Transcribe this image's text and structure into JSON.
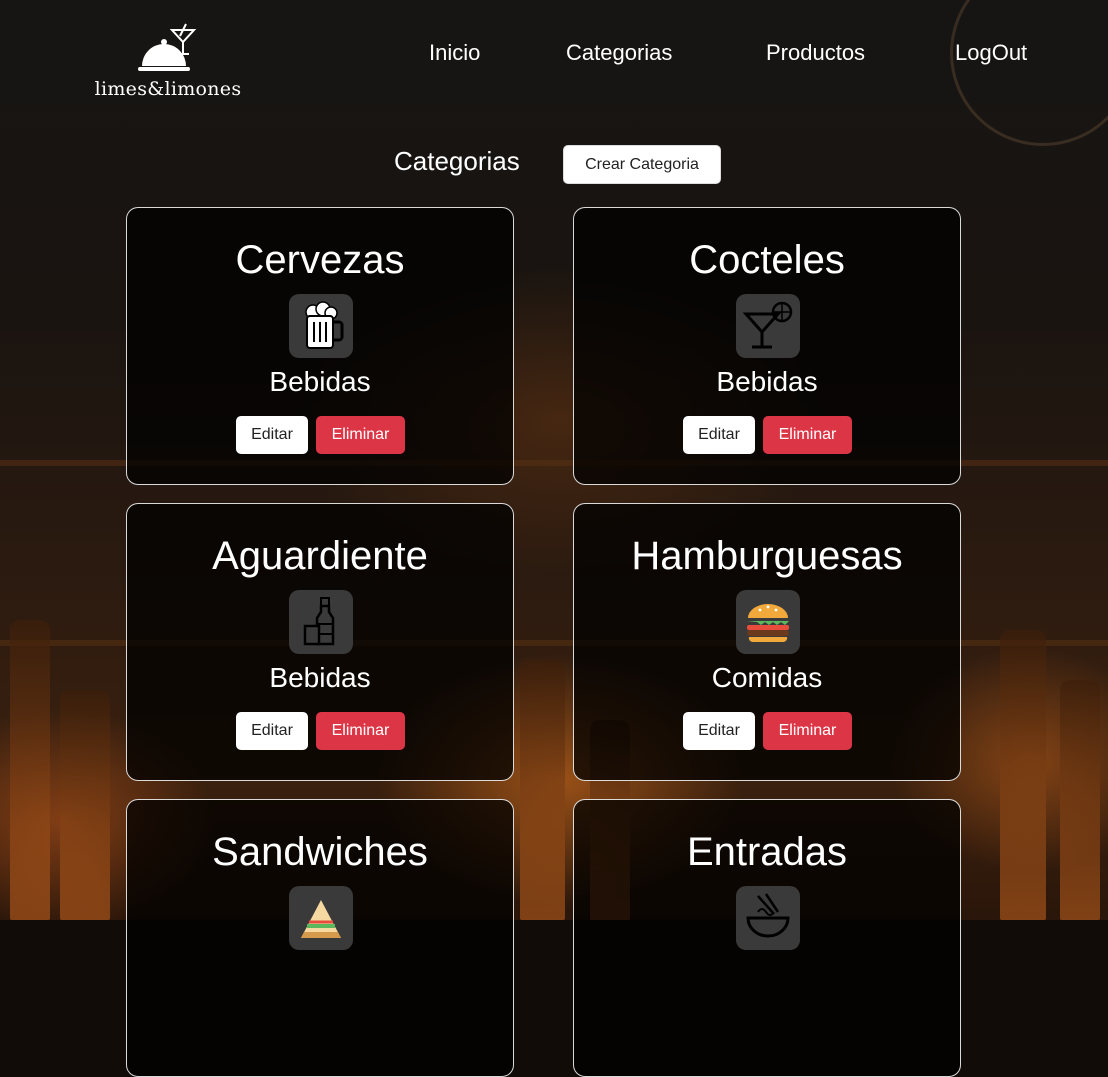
{
  "brand": {
    "name": "limes&limones",
    "icon": "cloche-cocktail-icon"
  },
  "nav": [
    {
      "label": "Inicio"
    },
    {
      "label": "Categorias"
    },
    {
      "label": "Productos"
    },
    {
      "label": "LogOut"
    }
  ],
  "page": {
    "title": "Categorias",
    "create_label": "Crear Categoria"
  },
  "actions": {
    "edit": "Editar",
    "delete": "Eliminar"
  },
  "categories": [
    {
      "name": "Cervezas",
      "group": "Bebidas",
      "icon": "beer-mug-icon"
    },
    {
      "name": "Cocteles",
      "group": "Bebidas",
      "icon": "cocktail-glass-icon"
    },
    {
      "name": "Aguardiente",
      "group": "Bebidas",
      "icon": "bottle-glass-icon"
    },
    {
      "name": "Hamburguesas",
      "group": "Comidas",
      "icon": "burger-icon"
    },
    {
      "name": "Sandwiches",
      "group": "",
      "icon": "sandwich-icon"
    },
    {
      "name": "Entradas",
      "group": "",
      "icon": "noodles-bowl-icon"
    }
  ],
  "colors": {
    "delete": "#dc3545",
    "card_bg": "rgba(0,0,0,0.74)",
    "text": "#ffffff"
  }
}
